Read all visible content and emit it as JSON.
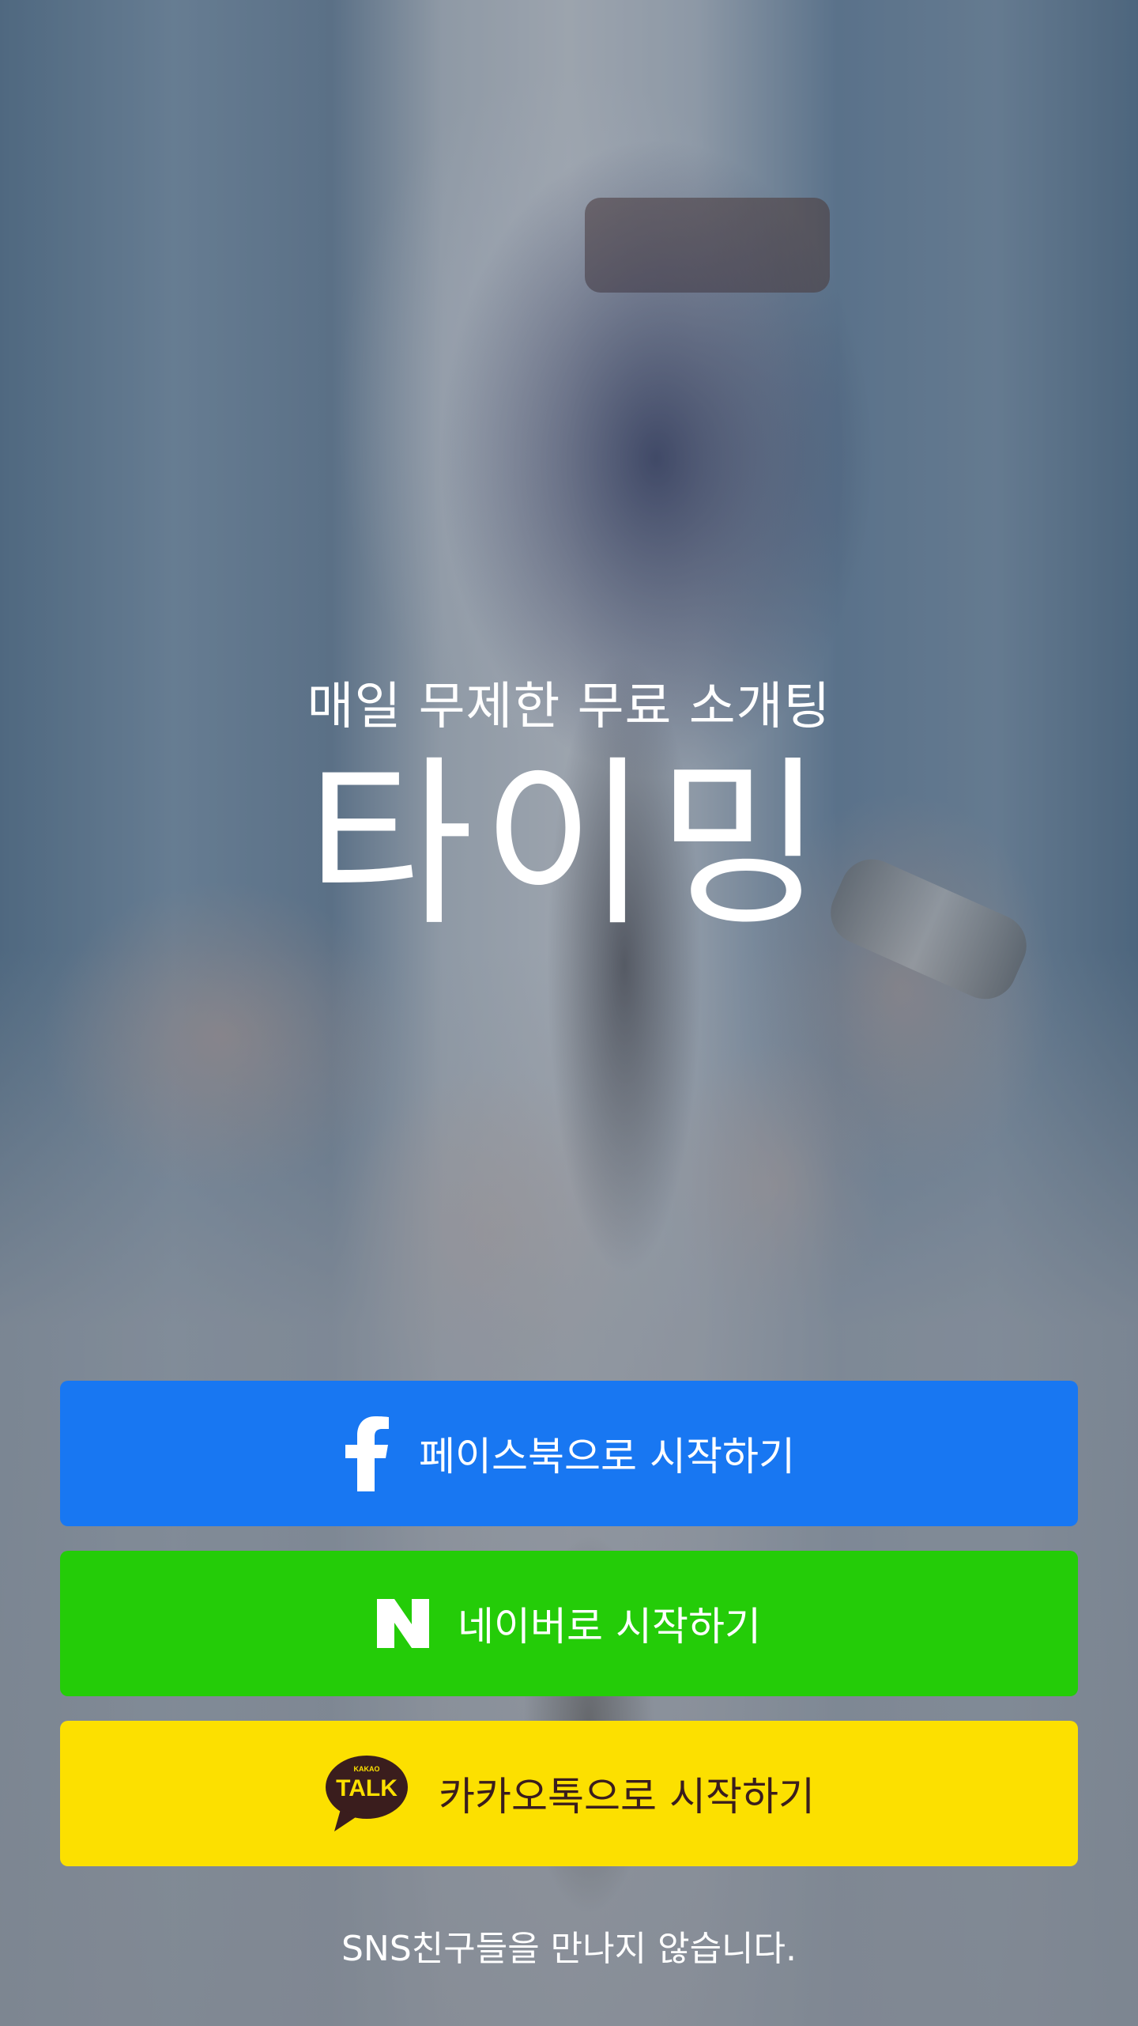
{
  "app": {
    "tagline": "매일 무제한 무료 소개팅",
    "logo_text": "타이밍"
  },
  "login": {
    "facebook_label": "페이스북으로 시작하기",
    "naver_label": "네이버로 시작하기",
    "kakao_label": "카카오톡으로 시작하기",
    "kakao_icon_text": "TALK",
    "kakao_icon_subtext": "KAKAO"
  },
  "footer": {
    "notice": "SNS친구들을 만나지 않습니다."
  },
  "colors": {
    "facebook": "#1877f2",
    "naver": "#24cc08",
    "kakao": "#fce000",
    "kakao_text": "#3a1d1d"
  },
  "icons": {
    "facebook": "facebook-f-icon",
    "naver": "naver-n-icon",
    "kakao": "kakao-talk-bubble-icon"
  }
}
